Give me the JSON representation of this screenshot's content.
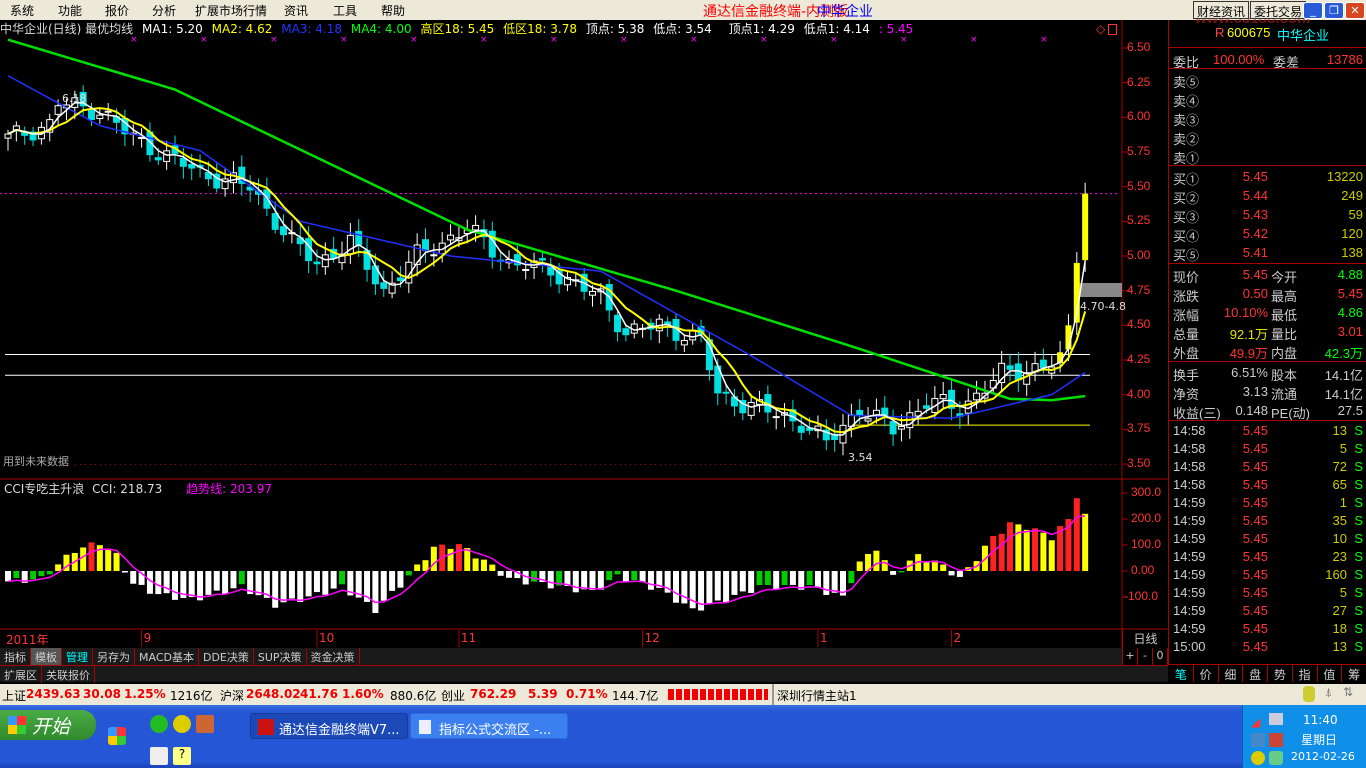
{
  "menu": {
    "items": [
      "系统",
      "功能",
      "报价",
      "分析",
      "扩展市场行情",
      "资讯",
      "工具",
      "帮助"
    ],
    "title": "通达信金融终端-内测版",
    "stock": "中华企业",
    "btn_news": "财经资讯",
    "btn_trade": "委托交易",
    "watermark": "www.55188.com"
  },
  "legend": {
    "name": "中华企业(日线) 最优均线",
    "ma1": "MA1: 5.20",
    "ma2": "MA2: 4.62",
    "ma3": "MA3: 4.18",
    "ma4": "MA4: 4.00",
    "high": "高区18: 5.45",
    "low": "低区18: 3.78",
    "top": "顶点: 5.38",
    "bottom": "低点: 3.54",
    "top1": "顶点1: 4.29",
    "bottom1": "低点1: 4.14",
    "last": ": 5.45"
  },
  "annotations": {
    "high_mark": "6.18",
    "low_mark": "3.54",
    "range": "4.70-4.8",
    "future": "用到未来数据"
  },
  "colors": {
    "up": "#ff3232",
    "down": "#00e0e0",
    "ma1": "#ffffff",
    "ma2": "#ffff00",
    "ma3": "#2030ff",
    "ma4": "#00e000",
    "cci_line": "#ff00ff"
  },
  "chart_data": {
    "type": "candlestick",
    "price_axis": [
      "6.50",
      "6.25",
      "6.00",
      "5.75",
      "5.50",
      "5.25",
      "5.00",
      "4.75",
      "4.50",
      "4.25",
      "4.00",
      "3.75",
      "3.50"
    ],
    "ylim": [
      3.5,
      6.5
    ],
    "bars": 130,
    "close_path": [
      [
        0,
        5.85
      ],
      [
        5,
        5.95
      ],
      [
        6,
        6.1
      ],
      [
        11,
        6.05
      ],
      [
        15,
        5.85
      ],
      [
        23,
        5.6
      ],
      [
        29,
        5.5
      ],
      [
        34,
        5.1
      ],
      [
        37,
        4.95
      ],
      [
        41,
        5.1
      ],
      [
        45,
        4.75
      ],
      [
        49,
        5.0
      ],
      [
        55,
        5.2
      ],
      [
        60,
        4.95
      ],
      [
        65,
        4.9
      ],
      [
        71,
        4.7
      ],
      [
        74,
        4.45
      ],
      [
        78,
        4.5
      ],
      [
        83,
        4.4
      ],
      [
        85,
        4.0
      ],
      [
        90,
        3.9
      ],
      [
        95,
        3.8
      ],
      [
        98,
        3.65
      ],
      [
        102,
        3.9
      ],
      [
        106,
        3.75
      ],
      [
        110,
        3.95
      ],
      [
        114,
        3.9
      ],
      [
        119,
        4.15
      ],
      [
        125,
        4.22
      ],
      [
        126,
        4.25
      ],
      [
        127,
        4.5
      ],
      [
        128,
        4.95
      ],
      [
        129,
        5.45
      ]
    ],
    "ma3_path": [
      [
        0,
        6.3
      ],
      [
        11,
        5.94
      ],
      [
        23,
        5.76
      ],
      [
        35,
        5.25
      ],
      [
        53,
        5.0
      ],
      [
        71,
        4.89
      ],
      [
        89,
        4.28
      ],
      [
        101,
        3.85
      ],
      [
        113,
        3.83
      ],
      [
        125,
        4.0
      ],
      [
        129,
        4.16
      ]
    ],
    "ma4_path": [
      [
        0,
        6.56
      ],
      [
        20,
        6.2
      ],
      [
        55,
        5.19
      ],
      [
        80,
        4.75
      ],
      [
        102,
        4.33
      ],
      [
        120,
        3.97
      ],
      [
        125,
        3.96
      ],
      [
        129,
        3.99
      ]
    ],
    "hlines": {
      "high_zone": 5.45,
      "low_zone": 3.78,
      "top1": 4.29,
      "bottom1": 4.14
    },
    "cci": {
      "title": "CCI专吃主升浪",
      "value": "CCI: 218.73",
      "trend_label": "趋势线: 203.97",
      "axis": [
        "300.0",
        "200.0",
        "100.0",
        "0.00",
        "-100.0"
      ],
      "ylim": [
        -150,
        330
      ],
      "path": [
        [
          0,
          -40
        ],
        [
          4,
          -30
        ],
        [
          8,
          80
        ],
        [
          11,
          110
        ],
        [
          13,
          60
        ],
        [
          15,
          -50
        ],
        [
          18,
          -90
        ],
        [
          22,
          -110
        ],
        [
          28,
          -60
        ],
        [
          32,
          -130
        ],
        [
          36,
          -100
        ],
        [
          40,
          -60
        ],
        [
          44,
          -150
        ],
        [
          48,
          -20
        ],
        [
          51,
          90
        ],
        [
          54,
          100
        ],
        [
          57,
          40
        ],
        [
          60,
          -30
        ],
        [
          66,
          -60
        ],
        [
          70,
          -80
        ],
        [
          73,
          -20
        ],
        [
          78,
          -70
        ],
        [
          82,
          -150
        ],
        [
          86,
          -110
        ],
        [
          90,
          -60
        ],
        [
          96,
          -60
        ],
        [
          100,
          -100
        ],
        [
          102,
          30
        ],
        [
          104,
          90
        ],
        [
          106,
          -20
        ],
        [
          109,
          60
        ],
        [
          112,
          20
        ],
        [
          114,
          -30
        ],
        [
          116,
          50
        ],
        [
          118,
          130
        ],
        [
          120,
          180
        ],
        [
          122,
          170
        ],
        [
          125,
          130
        ],
        [
          127,
          200
        ],
        [
          128,
          280
        ],
        [
          129,
          220
        ]
      ]
    },
    "time_axis": [
      {
        "label": "2011年",
        "bar": 0
      },
      {
        "label": "9",
        "bar": 16
      },
      {
        "label": "10",
        "bar": 37
      },
      {
        "label": "11",
        "bar": 54
      },
      {
        "label": "12",
        "bar": 76
      },
      {
        "label": "1",
        "bar": 97
      },
      {
        "label": "2",
        "bar": 113
      }
    ]
  },
  "period": "日线",
  "zoom": [
    "+",
    "-",
    "0"
  ],
  "tabs": [
    "指标",
    "模板",
    "管理",
    "另存为",
    "MACD基本",
    "DDE决策",
    "SUP决策",
    "资金决策"
  ],
  "tabs2": [
    "扩展区",
    "关联报价"
  ],
  "quote": {
    "flag": "R",
    "code": "600675",
    "name": "中华企业",
    "weibi_label": "委比",
    "weibi": "100.00%",
    "weicha_label": "委差",
    "weicha": "13786",
    "sell": [
      {
        "label": "卖⑤"
      },
      {
        "label": "卖④"
      },
      {
        "label": "卖③"
      },
      {
        "label": "卖②"
      },
      {
        "label": "卖①"
      }
    ],
    "buy": [
      {
        "label": "买①",
        "price": "5.45",
        "vol": "13220"
      },
      {
        "label": "买②",
        "price": "5.44",
        "vol": "249"
      },
      {
        "label": "买③",
        "price": "5.43",
        "vol": "59"
      },
      {
        "label": "买④",
        "price": "5.42",
        "vol": "120"
      },
      {
        "label": "买⑤",
        "price": "5.41",
        "vol": "138"
      }
    ],
    "stats": [
      {
        "l1": "现价",
        "v1": "5.45",
        "c1": "#ff3232",
        "l2": "今开",
        "v2": "4.88",
        "c2": "#00ff00"
      },
      {
        "l1": "涨跌",
        "v1": "0.50",
        "c1": "#ff3232",
        "l2": "最高",
        "v2": "5.45",
        "c2": "#ff3232"
      },
      {
        "l1": "涨幅",
        "v1": "10.10%",
        "c1": "#ff3232",
        "l2": "最低",
        "v2": "4.86",
        "c2": "#00ff00"
      },
      {
        "l1": "总量",
        "v1": "92.1万",
        "c1": "#e0e000",
        "l2": "量比",
        "v2": "3.01",
        "c2": "#ff3232"
      },
      {
        "l1": "外盘",
        "v1": "49.9万",
        "c1": "#ff3232",
        "l2": "内盘",
        "v2": "42.3万",
        "c2": "#00ff00"
      }
    ],
    "stats2": [
      {
        "l1": "换手",
        "v1": "6.51%",
        "l2": "股本",
        "v2": "14.1亿"
      },
      {
        "l1": "净资",
        "v1": "3.13",
        "l2": "流通",
        "v2": "14.1亿"
      },
      {
        "l1": "收益(三)",
        "v1": "0.148",
        "l2": "PE(动)",
        "v2": "27.5"
      }
    ],
    "ticks": [
      {
        "t": "14:58",
        "p": "5.45",
        "v": "13",
        "s": "S"
      },
      {
        "t": "14:58",
        "p": "5.45",
        "v": "5",
        "s": "S"
      },
      {
        "t": "14:58",
        "p": "5.45",
        "v": "72",
        "s": "S"
      },
      {
        "t": "14:58",
        "p": "5.45",
        "v": "65",
        "s": "S"
      },
      {
        "t": "14:59",
        "p": "5.45",
        "v": "1",
        "s": "S"
      },
      {
        "t": "14:59",
        "p": "5.45",
        "v": "35",
        "s": "S"
      },
      {
        "t": "14:59",
        "p": "5.45",
        "v": "10",
        "s": "S"
      },
      {
        "t": "14:59",
        "p": "5.45",
        "v": "23",
        "s": "S"
      },
      {
        "t": "14:59",
        "p": "5.45",
        "v": "160",
        "s": "S"
      },
      {
        "t": "14:59",
        "p": "5.45",
        "v": "5",
        "s": "S"
      },
      {
        "t": "14:59",
        "p": "5.45",
        "v": "27",
        "s": "S"
      },
      {
        "t": "14:59",
        "p": "5.45",
        "v": "18",
        "s": "S"
      },
      {
        "t": "15:00",
        "p": "5.45",
        "v": "13",
        "s": "S"
      }
    ],
    "tabs": [
      "笔",
      "价",
      "细",
      "盘",
      "势",
      "指",
      "值",
      "筹"
    ]
  },
  "status": {
    "sh_label": "上证",
    "sh": "2439.63",
    "sh_chg": "30.08",
    "sh_pct": "1.25%",
    "sh_amt": "1216亿",
    "hs_label": "沪深",
    "hs": "2648.02",
    "hs_chg": "41.76",
    "hs_pct": "1.60%",
    "hs_amt": "880.6亿",
    "cy_label": "创业",
    "cy": "762.29",
    "cy_chg": "5.39",
    "cy_pct": "0.71%",
    "cy_amt": "144.7亿",
    "server": "深圳行情主站1"
  },
  "taskbar": {
    "start": "开始",
    "tasks": [
      "通达信金融终端V7...",
      "指标公式交流区 -..."
    ],
    "time": "11:40",
    "weekday": "星期日",
    "date": "2012-02-26"
  }
}
